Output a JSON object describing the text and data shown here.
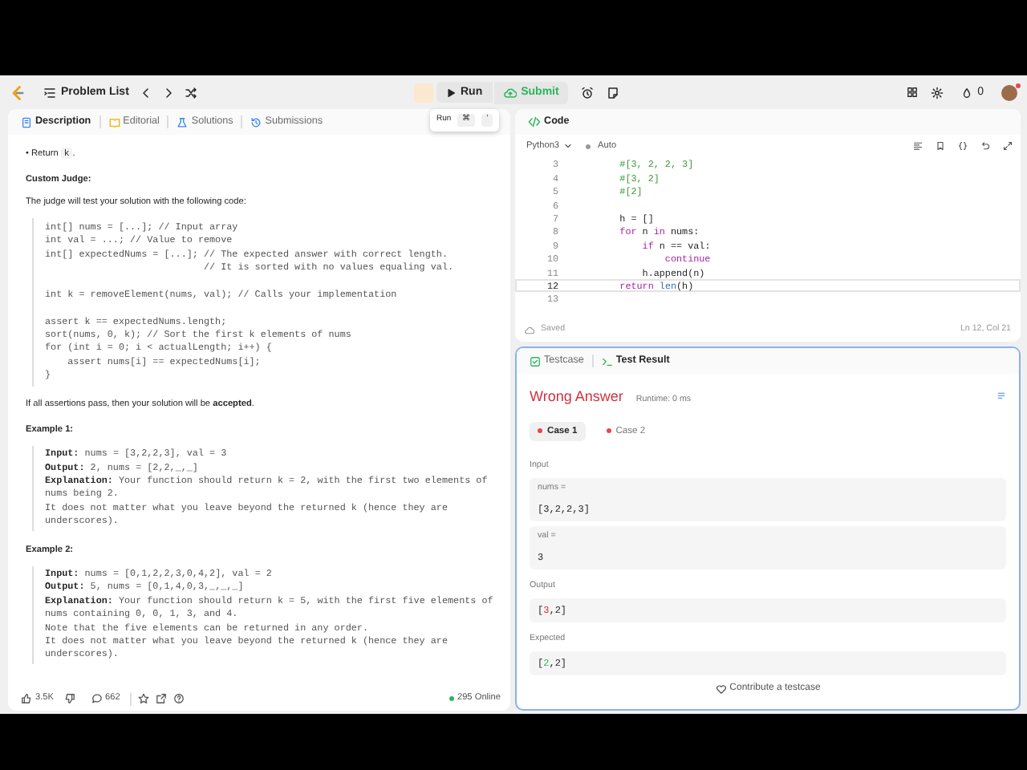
{
  "nav": {
    "problem_list": "Problem List",
    "run": "Run",
    "submit": "Submit",
    "tooltip": {
      "label": "Run",
      "keys": [
        "⌘",
        "'"
      ]
    },
    "streak": "0"
  },
  "left_tabs": [
    {
      "label": "Description",
      "selected": true,
      "kind": "doc"
    },
    {
      "label": "Editorial",
      "selected": false,
      "kind": "book"
    },
    {
      "label": "Solutions",
      "selected": false,
      "kind": "flask"
    },
    {
      "label": "Submissions",
      "selected": false,
      "kind": "history"
    }
  ],
  "description": [
    {
      "kind": "bullet",
      "marker": "•",
      "text": "Return ",
      "code": "k",
      "after": "."
    },
    {
      "kind": "heading",
      "text": "Custom Judge:"
    },
    {
      "kind": "para",
      "text": "The judge will test your solution with the following code:"
    },
    {
      "kind": "code",
      "text": "int[] nums = [...]; // Input array\nint val = ...; // Value to remove\nint[] expectedNums = [...]; // The expected answer with correct length.\n                            // It is sorted with no values equaling val.\n\nint k = removeElement(nums, val); // Calls your implementation\n\nassert k == expectedNums.length;\nsort(nums, 0, k); // Sort the first k elements of nums\nfor (int i = 0; i < actualLength; i++) {\n    assert nums[i] == expectedNums[i];\n}"
    },
    {
      "kind": "para",
      "text": "If all assertions pass, then your solution will be **accepted**."
    },
    {
      "kind": "heading",
      "text": "Example 1:"
    },
    {
      "kind": "example",
      "lines": [
        {
          "label": "Input:",
          "text": "nums = [3,2,2,3], val = 3"
        },
        {
          "label": "Output:",
          "text": "2, nums = [2,2,_,_]"
        },
        {
          "label": "Explanation:",
          "text": "Your function should return k = 2, with the first two elements of nums being 2."
        },
        {
          "text": "It does not matter what you leave beyond the returned k (hence they are underscores)."
        }
      ]
    },
    {
      "kind": "heading",
      "text": "Example 2:"
    },
    {
      "kind": "example",
      "lines": [
        {
          "label": "Input:",
          "text": "nums = [0,1,2,2,3,0,4,2], val = 2"
        },
        {
          "label": "Output:",
          "text": "5, nums = [0,1,4,0,3,_,_,_]"
        },
        {
          "label": "Explanation:",
          "text": "Your function should return k = 5, with the first five elements of nums containing 0, 0, 1, 3, and 4."
        },
        {
          "text": "Note that the five elements can be returned in any order."
        },
        {
          "text": "It does not matter what you leave beyond the returned k (hence they are underscores)."
        }
      ]
    }
  ],
  "left_footer": {
    "likes": "3.5K",
    "comments": "662",
    "online": "295 Online"
  },
  "editor": {
    "title": "Code",
    "language": "Python3",
    "mode": "Auto",
    "saved": "Saved",
    "position": "Ln 12, Col 21",
    "lines": [
      {
        "num": "3",
        "current": false,
        "tokens": [
          {
            "text": "    #[3, 2, 2, 3]",
            "kind": "comment"
          }
        ]
      },
      {
        "num": "4",
        "current": false,
        "tokens": [
          {
            "text": "    #[3, 2]",
            "kind": "comment"
          }
        ]
      },
      {
        "num": "5",
        "current": false,
        "tokens": [
          {
            "text": "    #[2]",
            "kind": "comment"
          }
        ]
      },
      {
        "num": "6",
        "current": false
      },
      {
        "num": "7",
        "current": false,
        "tokens": [
          {
            "text": "    h = []",
            "kind": "plain"
          }
        ]
      },
      {
        "num": "8",
        "current": false,
        "tokens": [
          {
            "text": "    for",
            "kind": "keyword"
          },
          {
            "text": " n ",
            "kind": "plain"
          },
          {
            "text": "in",
            "kind": "keyword"
          },
          {
            "text": " nums:",
            "kind": "plain"
          }
        ]
      },
      {
        "num": "9",
        "current": false,
        "tokens": [
          {
            "text": "        if",
            "kind": "keyword"
          },
          {
            "text": " n == val:",
            "kind": "plain"
          }
        ]
      },
      {
        "num": "10",
        "current": false,
        "tokens": [
          {
            "text": "            continue",
            "kind": "keyword"
          }
        ]
      },
      {
        "num": "11",
        "current": false,
        "tokens": [
          {
            "text": "        h.append(n)",
            "kind": "plain"
          }
        ]
      },
      {
        "num": "12",
        "current": true,
        "tokens": [
          {
            "text": "    return",
            "kind": "keyword"
          },
          {
            "text": " len",
            "kind": "builtin"
          },
          {
            "text": "(h)",
            "kind": "plain"
          }
        ]
      },
      {
        "num": "13",
        "current": false
      }
    ]
  },
  "result": {
    "tabs": [
      {
        "label": "Testcase",
        "selected": false,
        "kind": "check"
      },
      {
        "label": "Test Result",
        "selected": true,
        "kind": "terminal"
      }
    ],
    "verdict": "Wrong Answer",
    "runtime": "Runtime: 0 ms",
    "cases": [
      {
        "label": "Case 1",
        "selected": true,
        "color": "#e5484d"
      },
      {
        "label": "Case 2",
        "selected": false,
        "color": "#e5484d"
      }
    ],
    "input_label": "Input",
    "inputs": [
      {
        "name": "nums =",
        "value": "[3,2,2,3]"
      },
      {
        "name": "val =",
        "value": "3"
      }
    ],
    "output_label": "Output",
    "output": [
      {
        "text": "["
      },
      {
        "text": "3",
        "diff": true
      },
      {
        "text": ",2]"
      }
    ],
    "expected_label": "Expected",
    "expected": [
      {
        "text": "["
      },
      {
        "text": "2",
        "diff": true
      },
      {
        "text": ",2]"
      }
    ],
    "contribute": "Contribute a testcase"
  }
}
